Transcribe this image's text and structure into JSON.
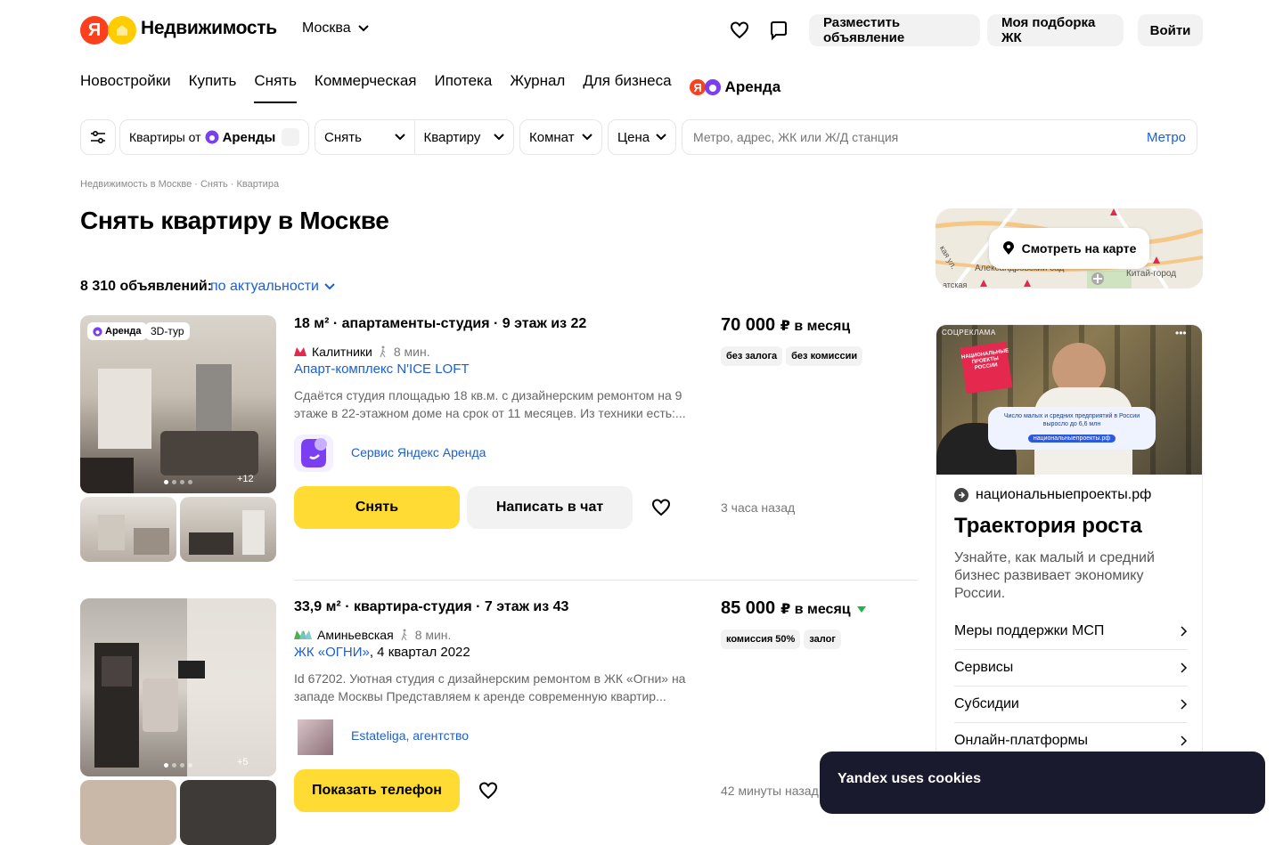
{
  "header": {
    "logo_letter": "Я",
    "logo_text": "Недвижимость",
    "city": "Москва",
    "place_ad": "Разместить объявление",
    "my_selection": "Моя подборка ЖК",
    "login": "Войти"
  },
  "nav": {
    "items": [
      "Новостройки",
      "Купить",
      "Снять",
      "Коммерческая",
      "Ипотека",
      "Журнал",
      "Для бизнеса"
    ],
    "active": "Снять",
    "arenda": "Аренда"
  },
  "filters": {
    "arenda_prefix": "Квартиры от",
    "arenda_brand": "Аренды",
    "deal": "Снять",
    "type": "Квартиру",
    "rooms": "Комнат",
    "price": "Цена",
    "search_placeholder": "Метро, адрес, ЖК или Ж/Д станция",
    "metro": "Метро"
  },
  "breadcrumb": [
    "Недвижимость в Москве",
    "Снять",
    "Квартира"
  ],
  "page_title": "Снять квартиру в Москве",
  "results": {
    "count": "8 310 объявлений:",
    "sort": "по актуальности"
  },
  "listings": [
    {
      "badge_arenda": "Аренда",
      "badge_3d": "3D-тур",
      "photo_more": "+12",
      "title": "18 м² · апартаменты-студия · 9 этаж из 22",
      "metro": "Калитники",
      "walk": "8 мин.",
      "complex": "Апарт-комплекс N'ICE LOFT",
      "complex_extra": "",
      "description": "Сдаётся студия площадью 18 кв.м. с дизайнерским ремонтом на 9 этаже в 22-этажном доме на срок от 11 месяцев. Из техники есть:...",
      "price": "70 000",
      "price_suffix": "₽ в месяц",
      "tags": [
        "без залога",
        "без комиссии"
      ],
      "agent": "Сервис Яндекс Аренда",
      "primary_button": "Снять",
      "chat_button": "Написать в чат",
      "time": "3 часа назад",
      "metro_color": "#e4284e"
    },
    {
      "photo_more": "+5",
      "title": "33,9 м² · квартира-студия · 7 этаж из 43",
      "metro": "Аминьевская",
      "walk": "8 мин.",
      "complex": "ЖК «ОГНИ»",
      "complex_extra": ", 4 квартал 2022",
      "description": "Id 67202. Уютная студия с дизайнерским ремонтом в ЖК «Огни» на западе Москвы Представляем к аренде современную квартир...",
      "price": "85 000",
      "price_suffix": "₽ в месяц",
      "tags": [
        "комиссия 50%",
        "залог"
      ],
      "agent": "Estateliga, агентство",
      "primary_button": "Показать телефон",
      "time": "42 минуты назад",
      "metro_color": "#4fb04f"
    }
  ],
  "map": {
    "button": "Смотреть на карте",
    "labels": [
      "Александровский сад",
      "Китай-город",
      "атская",
      "кая ул."
    ]
  },
  "ad": {
    "label": "СОЦРЕКЛАМА",
    "img_heading": "НАЦИОНАЛЬНЫЕ ПРОЕКТЫ РОССИИ",
    "img_text": "Число малых и средних предприятий в России выросло до 6,6 млн",
    "img_link": "национальныепроекты.рф",
    "domain": "национальныепроекты.рф",
    "title": "Траектория роста",
    "text": "Узнайте, как малый и средний бизнес развивает экономику России.",
    "links": [
      "Меры поддержки МСП",
      "Сервисы",
      "Субсидии",
      "Онлайн-платформы"
    ]
  },
  "cookie": "Yandex uses cookies",
  "colors": {
    "accent": "#ffdb33",
    "link": "#1a5fd6",
    "arenda_purple": "#7b3ff2"
  }
}
